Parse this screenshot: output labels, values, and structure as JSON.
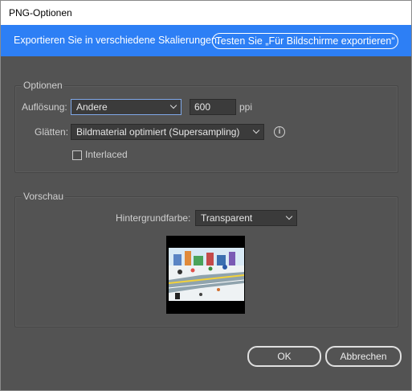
{
  "window": {
    "title": "PNG-Optionen"
  },
  "banner": {
    "message": "Exportieren Sie in verschiedene Skalierungen.",
    "link_label": "Testen Sie „Für Bildschirme exportieren“"
  },
  "options": {
    "group_title": "Optionen",
    "resolution_label": "Auflösung:",
    "resolution_value": "Andere",
    "ppi_value": "600",
    "ppi_unit": "ppi",
    "antialias_label": "Glätten:",
    "antialias_value": "Bildmaterial optimiert (Supersampling)",
    "interlaced_label": "Interlaced",
    "interlaced_checked": false
  },
  "preview": {
    "group_title": "Vorschau",
    "background_label": "Hintergrundfarbe:",
    "background_value": "Transparent"
  },
  "buttons": {
    "ok": "OK",
    "cancel": "Abbrechen"
  },
  "colors": {
    "accent": "#2d7ff5",
    "dialog_bg": "#535353"
  }
}
